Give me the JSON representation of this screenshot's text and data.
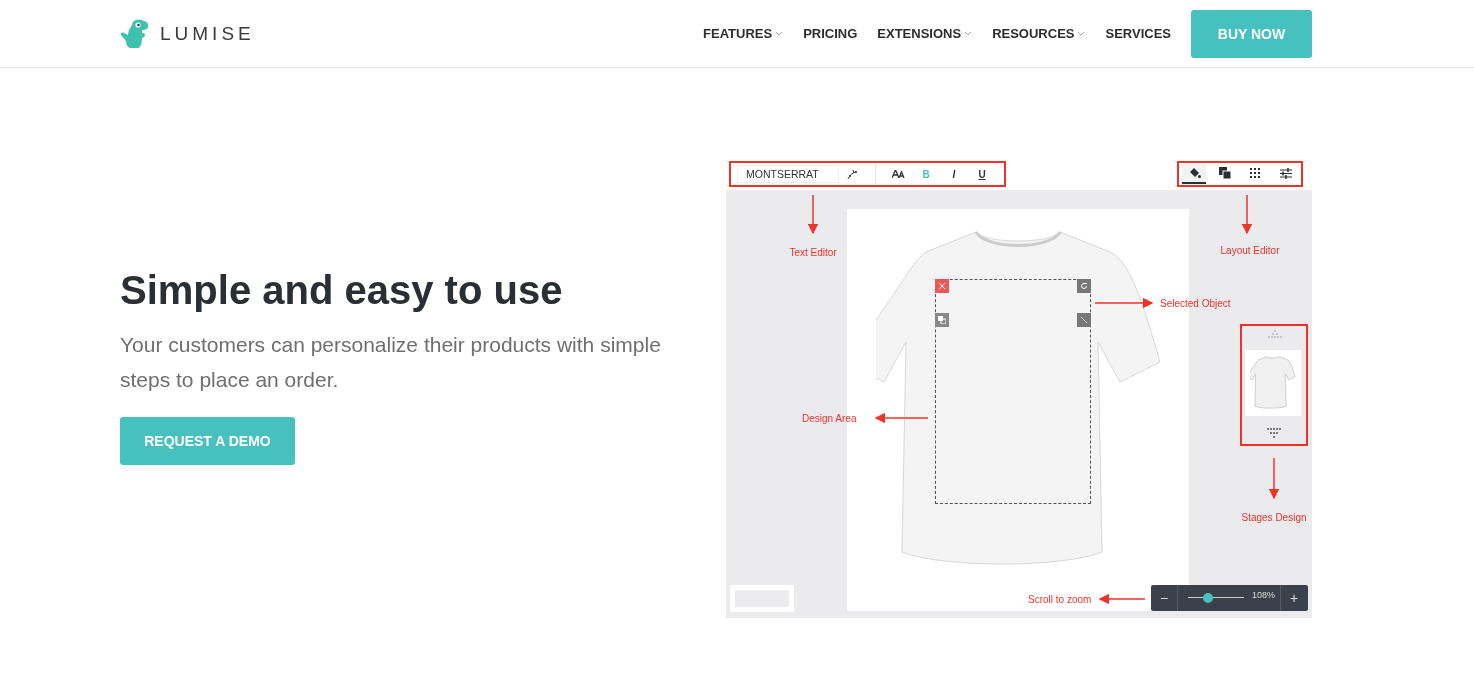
{
  "header": {
    "logo": "LUMISE",
    "nav": [
      {
        "label": "FEATURES",
        "dropdown": true
      },
      {
        "label": "PRICING",
        "dropdown": false
      },
      {
        "label": "EXTENSIONS",
        "dropdown": true
      },
      {
        "label": "RESOURCES",
        "dropdown": true
      },
      {
        "label": "SERVICES",
        "dropdown": false
      }
    ],
    "cta": "BUY NOW"
  },
  "hero": {
    "title": "Simple and easy to use",
    "text": "Your customers can personalize their products with simple steps to place an order.",
    "button": "REQUEST A DEMO"
  },
  "editor": {
    "font": "MONTSERRAT",
    "format_buttons": [
      {
        "kind": "size",
        "selected": false
      },
      {
        "kind": "bold",
        "label": "B",
        "selected": true
      },
      {
        "kind": "italic",
        "label": "I",
        "selected": false
      },
      {
        "kind": "underline",
        "label": "U",
        "selected": false
      }
    ],
    "layout_tools": [
      {
        "kind": "fill",
        "selected": true
      },
      {
        "kind": "layers",
        "selected": false
      },
      {
        "kind": "grid",
        "selected": false
      },
      {
        "kind": "sliders",
        "selected": false
      }
    ],
    "zoom": {
      "minus": "−",
      "level": 0.35,
      "reading": "108%",
      "plus": "+"
    },
    "annotations": [
      {
        "kind": "text-editor",
        "label": "Text Editor"
      },
      {
        "kind": "layout-editor",
        "label": "Layout Editor"
      },
      {
        "kind": "selected-object",
        "label": "Selected Object"
      },
      {
        "kind": "design-area",
        "label": "Design Area"
      },
      {
        "kind": "stages-design",
        "label": "Stages Design"
      },
      {
        "kind": "scroll-zoom",
        "label": "Scroll to zoom"
      }
    ]
  }
}
